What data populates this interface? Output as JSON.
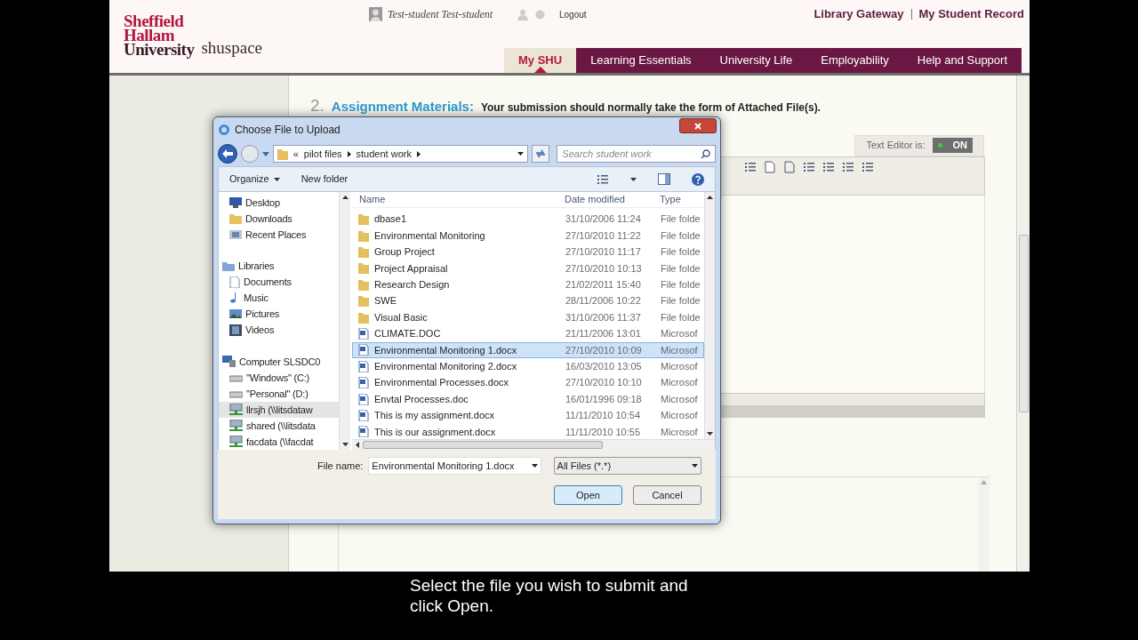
{
  "header": {
    "logo_lines": [
      "Sheffield",
      "Hallam",
      "University"
    ],
    "site_name": "shuspace",
    "user": "Test-student Test-student",
    "logout": "Logout",
    "links": [
      "Library Gateway",
      "My Student Record"
    ]
  },
  "nav": [
    {
      "label": "My SHU",
      "selected": true
    },
    {
      "label": "Learning Essentials",
      "selected": false
    },
    {
      "label": "University Life",
      "selected": false
    },
    {
      "label": "Employability",
      "selected": false
    },
    {
      "label": "Help and Support",
      "selected": false
    }
  ],
  "section": {
    "number": "2.",
    "title": "Assignment Materials:",
    "text": "Your submission should normally take the form of Attached File(s)."
  },
  "text_editor": {
    "label": "Text Editor is:",
    "state": "ON",
    "on": true
  },
  "dialog": {
    "title": "Choose File to Upload",
    "path_prefix": "«",
    "path": [
      "pilot files",
      "student work"
    ],
    "search": {
      "placeholder": "Search student work"
    },
    "toolbar": [
      "Organize",
      "New folder"
    ],
    "sidebar": [
      {
        "label": "Desktop",
        "kind": "desktop",
        "selected": false
      },
      {
        "label": "Downloads",
        "kind": "folder",
        "selected": false
      },
      {
        "label": "Recent Places",
        "kind": "recent",
        "selected": false
      },
      {
        "label": "Libraries",
        "kind": "library",
        "selected": false,
        "children": [
          {
            "label": "Documents",
            "kind": "document",
            "selected": false
          },
          {
            "label": "Music",
            "kind": "music",
            "selected": false
          },
          {
            "label": "Pictures",
            "kind": "pictures",
            "selected": false
          },
          {
            "label": "Videos",
            "kind": "videos",
            "selected": false
          }
        ]
      },
      {
        "label": "Computer SLSDC0",
        "kind": "computer",
        "selected": false,
        "children": [
          {
            "label": "\"Windows\" (C:)",
            "kind": "drive",
            "selected": false
          },
          {
            "label": "\"Personal\" (D:)",
            "kind": "drive",
            "selected": false
          },
          {
            "label": "llrsjh (\\\\litsdataw",
            "kind": "network",
            "selected": true
          },
          {
            "label": "shared (\\\\litsdata",
            "kind": "network",
            "selected": false
          },
          {
            "label": "facdata (\\\\facdat",
            "kind": "network",
            "selected": false
          }
        ]
      }
    ],
    "columns": [
      "Name",
      "Date modified",
      "Type"
    ],
    "rows": [
      {
        "kind": "folder",
        "name": "dbase1",
        "date": "31/10/2006 11:24",
        "type": "File folde",
        "selected": false
      },
      {
        "kind": "folder",
        "name": "Environmental Monitoring",
        "date": "27/10/2010 11:22",
        "type": "File folde",
        "selected": false
      },
      {
        "kind": "folder",
        "name": "Group Project",
        "date": "27/10/2010 11:17",
        "type": "File folde",
        "selected": false
      },
      {
        "kind": "folder",
        "name": "Project Appraisal",
        "date": "27/10/2010 10:13",
        "type": "File folde",
        "selected": false
      },
      {
        "kind": "folder",
        "name": "Research Design",
        "date": "21/02/2011 15:40",
        "type": "File folde",
        "selected": false
      },
      {
        "kind": "folder",
        "name": "SWE",
        "date": "28/11/2006 10:22",
        "type": "File folde",
        "selected": false
      },
      {
        "kind": "folder",
        "name": "Visual Basic",
        "date": "31/10/2006 11:37",
        "type": "File folde",
        "selected": false
      },
      {
        "kind": "doc",
        "name": "CLIMATE.DOC",
        "date": "21/11/2006 13:01",
        "type": "Microsof",
        "selected": false
      },
      {
        "kind": "doc",
        "name": "Environmental Monitoring 1.docx",
        "date": "27/10/2010 10:09",
        "type": "Microsof",
        "selected": true
      },
      {
        "kind": "doc",
        "name": "Environmental Monitoring 2.docx",
        "date": "16/03/2010 13:05",
        "type": "Microsof",
        "selected": false
      },
      {
        "kind": "doc",
        "name": "Environmental Processes.docx",
        "date": "27/10/2010 10:10",
        "type": "Microsof",
        "selected": false
      },
      {
        "kind": "doc",
        "name": "Envtal Processes.doc",
        "date": "16/01/1996 09:18",
        "type": "Microsof",
        "selected": false
      },
      {
        "kind": "doc",
        "name": "This is my assignment.docx",
        "date": "11/11/2010 10:54",
        "type": "Microsof",
        "selected": false
      },
      {
        "kind": "doc",
        "name": "This is our assignment.docx",
        "date": "11/11/2010 10:55",
        "type": "Microsof",
        "selected": false
      }
    ],
    "file_name_label": "File name:",
    "file_name": "Environmental Monitoring 1.docx",
    "filter": "All Files (*.*)",
    "buttons": [
      {
        "label": "Open",
        "default": true
      },
      {
        "label": "Cancel",
        "default": false
      }
    ]
  },
  "caption": "Select the file you wish to submit and click Open."
}
